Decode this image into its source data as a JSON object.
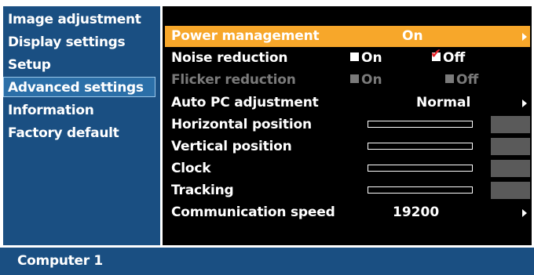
{
  "left_menu": {
    "items": [
      {
        "label": "Image adjustment",
        "selected": false
      },
      {
        "label": "Display settings",
        "selected": false
      },
      {
        "label": "Setup",
        "selected": false
      },
      {
        "label": "Advanced settings",
        "selected": true
      },
      {
        "label": "Information",
        "selected": false
      },
      {
        "label": "Factory default",
        "selected": false
      }
    ]
  },
  "main": {
    "power_management": {
      "label": "Power management",
      "value": "On"
    },
    "noise_reduction": {
      "label": "Noise reduction",
      "on_label": "On",
      "off_label": "Off",
      "selected": "Off"
    },
    "flicker_reduction": {
      "label": "Flicker reduction",
      "on_label": "On",
      "off_label": "Off",
      "enabled": false
    },
    "auto_pc_adjustment": {
      "label": "Auto PC adjustment",
      "value": "Normal"
    },
    "horizontal_position": {
      "label": "Horizontal position"
    },
    "vertical_position": {
      "label": "Vertical position"
    },
    "clock": {
      "label": "Clock"
    },
    "tracking": {
      "label": "Tracking"
    },
    "communication_speed": {
      "label": "Communication speed",
      "value": "19200"
    }
  },
  "status_bar": {
    "source": "Computer 1"
  },
  "colors": {
    "menu_bg": "#1a4f82",
    "highlight": "#f7a72a",
    "panel_bg": "#000000",
    "check_red": "#e8252b",
    "disabled": "#7a7a7a"
  },
  "icons": {
    "submenu_arrow": "triangle-right",
    "checkbox_checked": "red-check",
    "checkbox_empty": "white-square"
  }
}
